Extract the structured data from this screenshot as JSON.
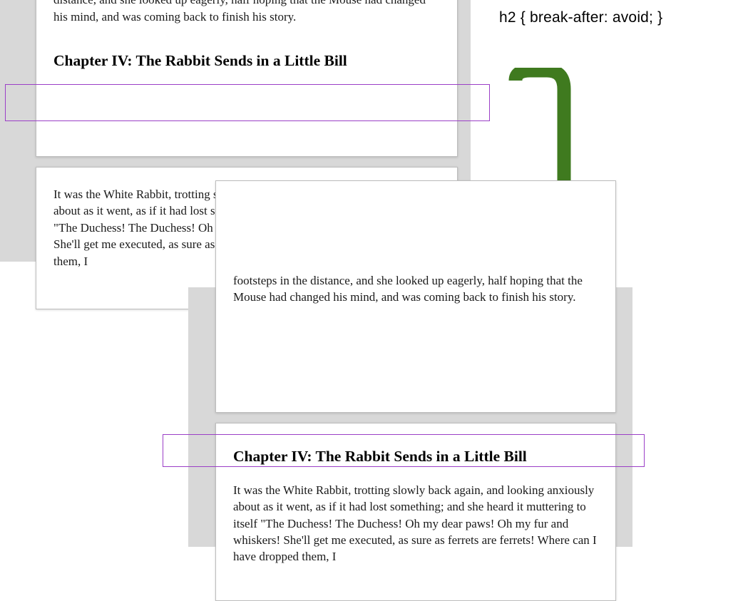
{
  "code_label": "h2 { break-after: avoid; }",
  "chapter_heading": "Chapter IV: The Rabbit Sends in a Little Bill",
  "para_top_clipped": "little while, however, she again heard a little pattering of footsteps in the distance, and she looked up eagerly, half hoping that the Mouse had changed his mind, and was coming back to finish his story.",
  "para_top_clipped_2": "footsteps in the distance, and she looked up eagerly, half hoping that the Mouse had changed his mind, and was coming back to finish his story.",
  "para_body": "It was the White Rabbit, trotting slowly back again, and looking anxiously about as it went, as if it had lost something; and she heard it muttering to itself \"The Duchess! The Duchess! Oh my dear paws! Oh my fur and whiskers! She'll get me executed, as sure as ferrets are ferrets! Where can I have dropped them, I",
  "arrow_color": "#3f7a1f"
}
